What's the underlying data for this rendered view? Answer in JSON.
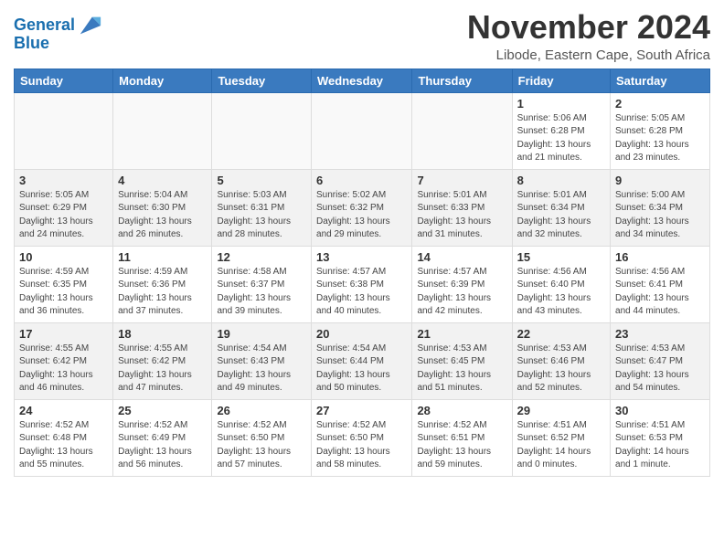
{
  "header": {
    "logo_line1": "General",
    "logo_line2": "Blue",
    "title": "November 2024",
    "subtitle": "Libode, Eastern Cape, South Africa"
  },
  "days_of_week": [
    "Sunday",
    "Monday",
    "Tuesday",
    "Wednesday",
    "Thursday",
    "Friday",
    "Saturday"
  ],
  "weeks": [
    [
      {
        "day": "",
        "info": ""
      },
      {
        "day": "",
        "info": ""
      },
      {
        "day": "",
        "info": ""
      },
      {
        "day": "",
        "info": ""
      },
      {
        "day": "",
        "info": ""
      },
      {
        "day": "1",
        "info": "Sunrise: 5:06 AM\nSunset: 6:28 PM\nDaylight: 13 hours\nand 21 minutes."
      },
      {
        "day": "2",
        "info": "Sunrise: 5:05 AM\nSunset: 6:28 PM\nDaylight: 13 hours\nand 23 minutes."
      }
    ],
    [
      {
        "day": "3",
        "info": "Sunrise: 5:05 AM\nSunset: 6:29 PM\nDaylight: 13 hours\nand 24 minutes."
      },
      {
        "day": "4",
        "info": "Sunrise: 5:04 AM\nSunset: 6:30 PM\nDaylight: 13 hours\nand 26 minutes."
      },
      {
        "day": "5",
        "info": "Sunrise: 5:03 AM\nSunset: 6:31 PM\nDaylight: 13 hours\nand 28 minutes."
      },
      {
        "day": "6",
        "info": "Sunrise: 5:02 AM\nSunset: 6:32 PM\nDaylight: 13 hours\nand 29 minutes."
      },
      {
        "day": "7",
        "info": "Sunrise: 5:01 AM\nSunset: 6:33 PM\nDaylight: 13 hours\nand 31 minutes."
      },
      {
        "day": "8",
        "info": "Sunrise: 5:01 AM\nSunset: 6:34 PM\nDaylight: 13 hours\nand 32 minutes."
      },
      {
        "day": "9",
        "info": "Sunrise: 5:00 AM\nSunset: 6:34 PM\nDaylight: 13 hours\nand 34 minutes."
      }
    ],
    [
      {
        "day": "10",
        "info": "Sunrise: 4:59 AM\nSunset: 6:35 PM\nDaylight: 13 hours\nand 36 minutes."
      },
      {
        "day": "11",
        "info": "Sunrise: 4:59 AM\nSunset: 6:36 PM\nDaylight: 13 hours\nand 37 minutes."
      },
      {
        "day": "12",
        "info": "Sunrise: 4:58 AM\nSunset: 6:37 PM\nDaylight: 13 hours\nand 39 minutes."
      },
      {
        "day": "13",
        "info": "Sunrise: 4:57 AM\nSunset: 6:38 PM\nDaylight: 13 hours\nand 40 minutes."
      },
      {
        "day": "14",
        "info": "Sunrise: 4:57 AM\nSunset: 6:39 PM\nDaylight: 13 hours\nand 42 minutes."
      },
      {
        "day": "15",
        "info": "Sunrise: 4:56 AM\nSunset: 6:40 PM\nDaylight: 13 hours\nand 43 minutes."
      },
      {
        "day": "16",
        "info": "Sunrise: 4:56 AM\nSunset: 6:41 PM\nDaylight: 13 hours\nand 44 minutes."
      }
    ],
    [
      {
        "day": "17",
        "info": "Sunrise: 4:55 AM\nSunset: 6:42 PM\nDaylight: 13 hours\nand 46 minutes."
      },
      {
        "day": "18",
        "info": "Sunrise: 4:55 AM\nSunset: 6:42 PM\nDaylight: 13 hours\nand 47 minutes."
      },
      {
        "day": "19",
        "info": "Sunrise: 4:54 AM\nSunset: 6:43 PM\nDaylight: 13 hours\nand 49 minutes."
      },
      {
        "day": "20",
        "info": "Sunrise: 4:54 AM\nSunset: 6:44 PM\nDaylight: 13 hours\nand 50 minutes."
      },
      {
        "day": "21",
        "info": "Sunrise: 4:53 AM\nSunset: 6:45 PM\nDaylight: 13 hours\nand 51 minutes."
      },
      {
        "day": "22",
        "info": "Sunrise: 4:53 AM\nSunset: 6:46 PM\nDaylight: 13 hours\nand 52 minutes."
      },
      {
        "day": "23",
        "info": "Sunrise: 4:53 AM\nSunset: 6:47 PM\nDaylight: 13 hours\nand 54 minutes."
      }
    ],
    [
      {
        "day": "24",
        "info": "Sunrise: 4:52 AM\nSunset: 6:48 PM\nDaylight: 13 hours\nand 55 minutes."
      },
      {
        "day": "25",
        "info": "Sunrise: 4:52 AM\nSunset: 6:49 PM\nDaylight: 13 hours\nand 56 minutes."
      },
      {
        "day": "26",
        "info": "Sunrise: 4:52 AM\nSunset: 6:50 PM\nDaylight: 13 hours\nand 57 minutes."
      },
      {
        "day": "27",
        "info": "Sunrise: 4:52 AM\nSunset: 6:50 PM\nDaylight: 13 hours\nand 58 minutes."
      },
      {
        "day": "28",
        "info": "Sunrise: 4:52 AM\nSunset: 6:51 PM\nDaylight: 13 hours\nand 59 minutes."
      },
      {
        "day": "29",
        "info": "Sunrise: 4:51 AM\nSunset: 6:52 PM\nDaylight: 14 hours\nand 0 minutes."
      },
      {
        "day": "30",
        "info": "Sunrise: 4:51 AM\nSunset: 6:53 PM\nDaylight: 14 hours\nand 1 minute."
      }
    ]
  ]
}
